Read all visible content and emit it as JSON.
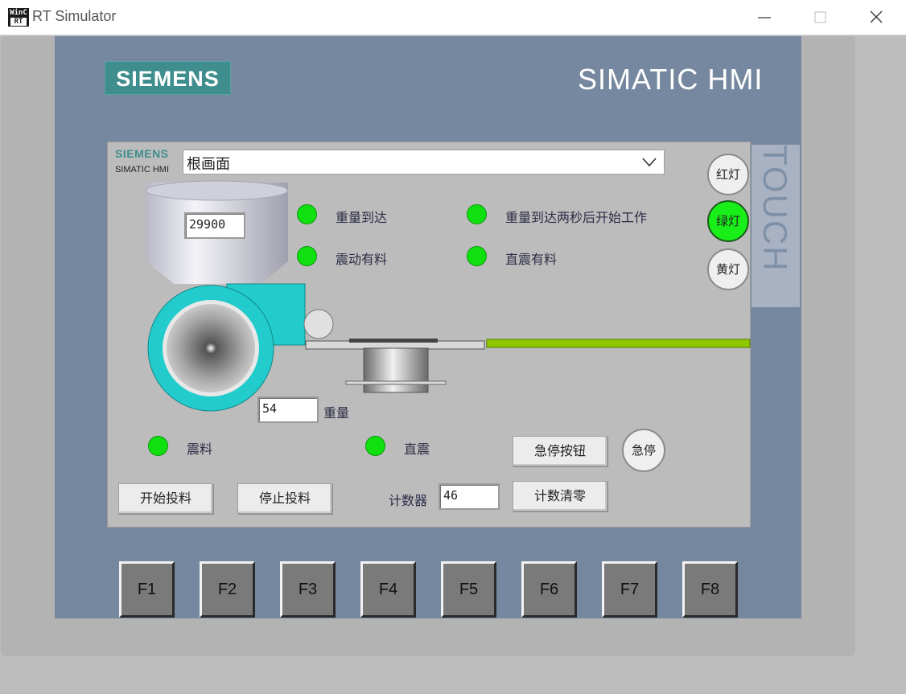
{
  "window": {
    "icon_line1": "WinC",
    "icon_line2": "RT",
    "title": "RT Simulator"
  },
  "device": {
    "brand": "SIEMENS",
    "model": "SIMATIC HMI",
    "touch": "TOUCH"
  },
  "screen": {
    "logo": "SIEMENS",
    "logo_sub": "SIMATIC HMI",
    "selector_value": "根画面",
    "hopper_value": "29900",
    "weight_value": "54",
    "weight_label": "重量",
    "indicators": [
      {
        "label": "重量到达"
      },
      {
        "label": "重量到达两秒后开始工作"
      },
      {
        "label": "震动有料"
      },
      {
        "label": "直震有料"
      },
      {
        "label": "震料"
      },
      {
        "label": "直震"
      }
    ],
    "lamps": {
      "red": "红灯",
      "green": "绿灯",
      "yellow": "黄灯"
    },
    "buttons": {
      "estop_button": "急停按钮",
      "estop": "急停",
      "start_feed": "开始投料",
      "stop_feed": "停止投料",
      "counter_reset": "计数清零"
    },
    "counter_label": "计数器",
    "counter_value": "46"
  },
  "function_keys": [
    "F1",
    "F2",
    "F3",
    "F4",
    "F5",
    "F6",
    "F7",
    "F8"
  ],
  "colors": {
    "indicator_on": "#10e010",
    "conveyor": "#90c800",
    "fan": "#22cccc",
    "bezel": "#7588a0",
    "brand": "#3f8d8d"
  }
}
